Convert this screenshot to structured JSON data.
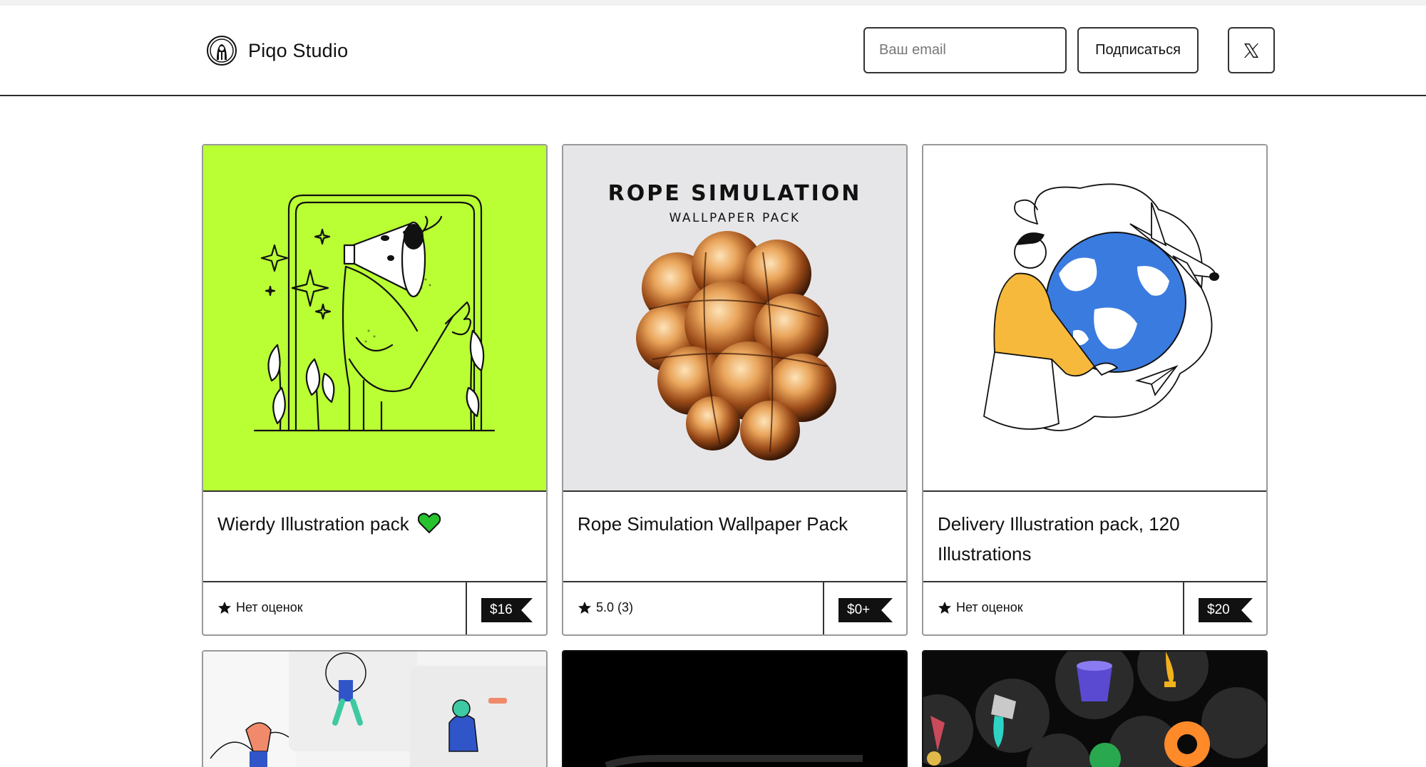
{
  "header": {
    "brand_name": "Piqo Studio",
    "email_placeholder": "Ваш email",
    "subscribe_label": "Подписаться",
    "x_icon": "x-logo-icon"
  },
  "products": [
    {
      "title": "Wierdy Illustration pack",
      "title_emoji": "green-heart-icon",
      "thumbnail_color": "#b9ff34",
      "rating_text": "Нет оценок",
      "price": "$16"
    },
    {
      "title": "Rope Simulation Wallpaper Pack",
      "thumbnail_title": "ROPE SIMULATION",
      "thumbnail_subtitle": "WALLPAPER PACK",
      "thumbnail_color": "#e6e6e8",
      "rating_text": "5.0 (3)",
      "price": "$0+"
    },
    {
      "title": "Delivery Illustration pack, 120 Illustrations",
      "thumbnail_color": "#ffffff",
      "rating_text": "Нет оценок",
      "price": "$20"
    }
  ],
  "products_row2": [
    {
      "thumbnail_color": "#f4f4f4"
    },
    {
      "thumbnail_color": "#000000"
    },
    {
      "thumbnail_color": "#0a0a0a"
    }
  ],
  "colors": {
    "accent_green": "#b9ff34",
    "heart_green": "#27c22d",
    "earth_blue": "#3a7be0",
    "shirt_yellow": "#f6b93b"
  }
}
